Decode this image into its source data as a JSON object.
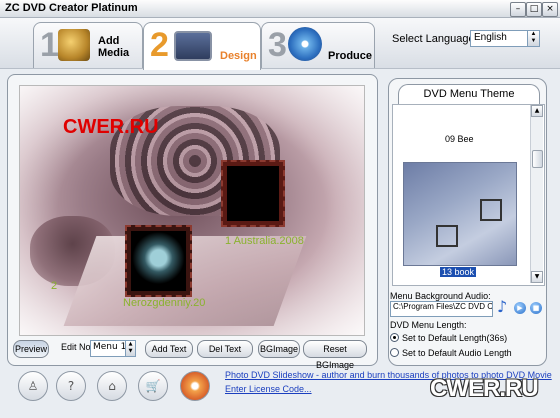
{
  "window": {
    "title": "ZC DVD Creator Platinum",
    "min": "–",
    "max": "□",
    "close": "×"
  },
  "steps": [
    {
      "num": "1",
      "label_line1": "Add",
      "label_line2": "Media",
      "active": false
    },
    {
      "num": "2",
      "label": "Design",
      "active": true
    },
    {
      "num": "3",
      "label": "Produce",
      "active": false
    }
  ],
  "language": {
    "label": "Select Language:",
    "value": "English"
  },
  "canvas": {
    "watermark": "CWER.RU",
    "clip_labels": [
      "1 Australia.2008",
      "2",
      "Nerozgdenniy.20"
    ]
  },
  "toolbar": {
    "preview": "Preview",
    "edit_no_label": "Edit No.",
    "menu_value": "Menu 1",
    "add_text": "Add Text",
    "del_text": "Del Text",
    "bg_image": "BGImage",
    "reset_bg": "Reset BGImage"
  },
  "theme": {
    "tab": "DVD Menu Theme",
    "item_above": "09 Bee",
    "selected": "13 book"
  },
  "audio": {
    "label": "Menu Background Audio:",
    "path": "C:\\Program Files\\ZC DVD Crea"
  },
  "length": {
    "label": "DVD Menu Length:",
    "opt1": "Set to Default Length(36s)",
    "opt2": "Set to Default Audio Length",
    "selected": "opt1"
  },
  "bottom": {
    "link1": "Photo DVD Slideshow - author and burn thousands of photos to photo DVD Movie",
    "link2": "Enter License Code...",
    "logo": "CWER.RU"
  }
}
